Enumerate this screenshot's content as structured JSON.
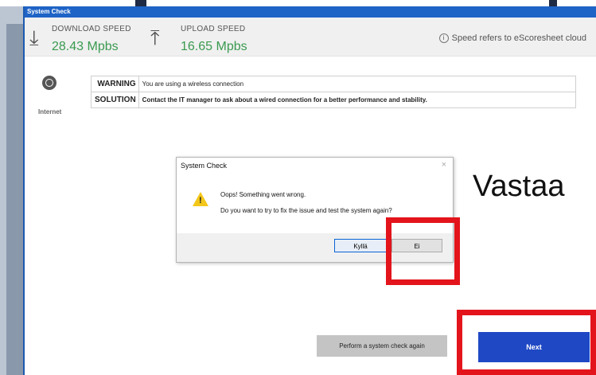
{
  "window": {
    "title": "System Check"
  },
  "speeds": {
    "download_label": "DOWNLOAD SPEED",
    "download_value": "28.43 Mpbs",
    "upload_label": "UPLOAD SPEED",
    "upload_value": "16.65 Mpbs",
    "info": "Speed refers to eScoresheet cloud"
  },
  "internet": {
    "label": "Internet",
    "issues": [
      {
        "tag": "WARNING",
        "text": "You are using a wireless connection"
      },
      {
        "tag": "SOLUTION",
        "text": "Contact the IT manager to ask about a wired connection for a better performance and stability."
      }
    ]
  },
  "overlay_text": "Vastaa",
  "dialog": {
    "title": "System Check",
    "close": "×",
    "line1": "Oops! Something went wrong.",
    "line2": "Do you want to try to fix the issue and test the system again?",
    "yes": "Kyllä",
    "no": "Ei"
  },
  "buttons": {
    "recheck": "Perform a system check again",
    "next": "Next"
  },
  "icons": [
    "download-arrow-icon",
    "upload-arrow-icon",
    "info-icon",
    "globe-icon",
    "warning-icon",
    "close-icon"
  ],
  "colors": {
    "accent": "#1e63c6",
    "next_button": "#1f48c4",
    "speed_green": "#3a9a50",
    "annotation_red": "#e3141b",
    "warning_orange": "#e08a00",
    "solution_green": "#2d9a47"
  }
}
